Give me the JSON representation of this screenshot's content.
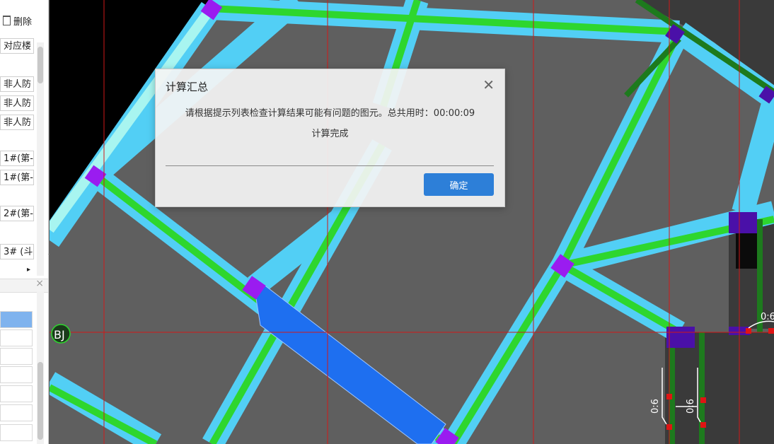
{
  "left_panel": {
    "delete_label": "删除",
    "column_header": "对应楼",
    "rows": [
      "非人防",
      "非人防",
      "非人防",
      "1#(第-",
      "1#(第-",
      "2#(第-",
      "3# (斗"
    ],
    "expand_arrow": "▸",
    "pane_close": "×"
  },
  "canvas": {
    "axis_label": "BJ",
    "dimension_labels": [
      "0:6",
      "0:6",
      "0:6"
    ],
    "colors": {
      "background": "#5f5f5f",
      "beam_blue": "#52cff5",
      "beam_green": "#2ed62e",
      "column_purple": "#9a1cf0",
      "grid_red": "#d01818",
      "selected_beam": "#1e6ff0"
    }
  },
  "dialog": {
    "title": "计算汇总",
    "close_icon": "close-icon",
    "message": "请根据提示列表检查计算结果可能有问题的图元。总共用时：00:00:09",
    "status": "计算完成",
    "ok_label": "确定",
    "accent_color": "#2d7fd8"
  }
}
